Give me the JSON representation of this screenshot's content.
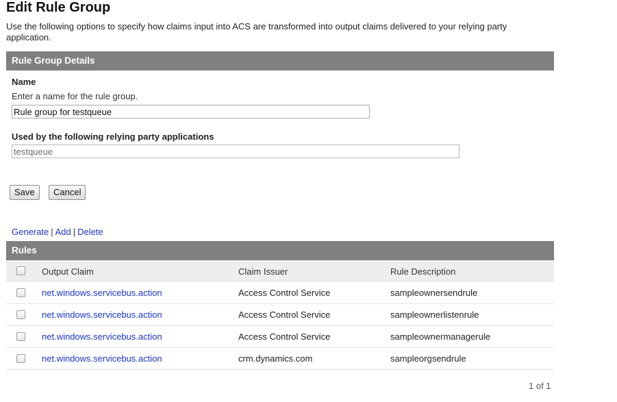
{
  "page": {
    "title": "Edit Rule Group",
    "description": "Use the following options to specify how claims input into ACS are transformed into output claims delivered to your relying party application."
  },
  "details": {
    "header": "Rule Group Details",
    "name_label": "Name",
    "name_help": "Enter a name for the rule group.",
    "name_value": "Rule group for testqueue",
    "rp_label": "Used by the following relying party applications",
    "rp_value": "testqueue"
  },
  "buttons": {
    "save": "Save",
    "cancel": "Cancel"
  },
  "actions": {
    "generate": "Generate",
    "add": "Add",
    "delete": "Delete",
    "separator": "|"
  },
  "rules": {
    "header": "Rules",
    "columns": {
      "output_claim": "Output Claim",
      "claim_issuer": "Claim Issuer",
      "rule_description": "Rule Description"
    },
    "rows": [
      {
        "output_claim": "net.windows.servicebus.action",
        "claim_issuer": "Access Control Service",
        "rule_description": "sampleownersendrule"
      },
      {
        "output_claim": "net.windows.servicebus.action",
        "claim_issuer": "Access Control Service",
        "rule_description": "sampleownerlistenrule"
      },
      {
        "output_claim": "net.windows.servicebus.action",
        "claim_issuer": "Access Control Service",
        "rule_description": "sampleownermanagerule"
      },
      {
        "output_claim": "net.windows.servicebus.action",
        "claim_issuer": "crm.dynamics.com",
        "rule_description": "sampleorgsendrule"
      }
    ]
  },
  "pager": {
    "text": "1 of 1"
  },
  "colors": {
    "header_bg": "#808080",
    "link": "#1a35c8",
    "table_head_bg": "#eeeeee"
  }
}
